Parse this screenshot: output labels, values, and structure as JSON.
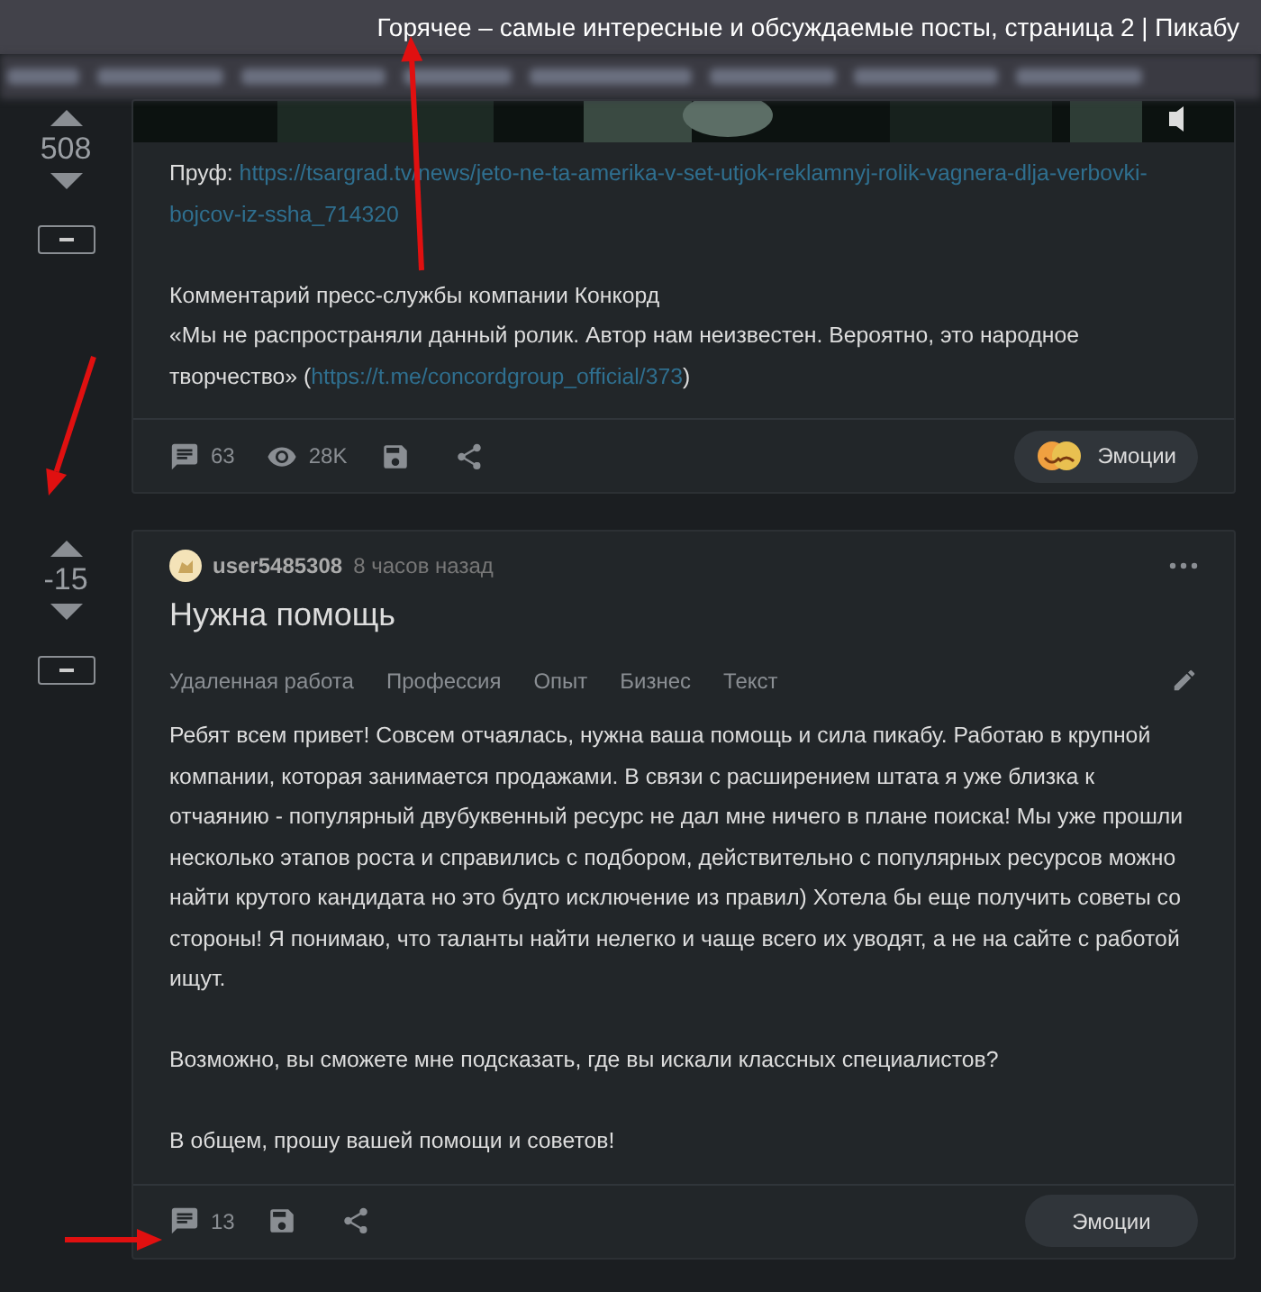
{
  "window": {
    "title": "Горячее – самые интересные и обсуждаемые посты, страница 2 | Пикабу"
  },
  "posts": [
    {
      "rating": "508",
      "media": {
        "kind": "picture"
      },
      "paragraphs": [
        [
          {
            "kind": "text",
            "text": "Пруф: "
          },
          {
            "kind": "link",
            "text": "https://tsargrad.tv/news/jeto-ne-ta-amerika-v-set-utjok-reklamnyj-rolik-vagnera-dlja-verbovki-"
          },
          {
            "kind": "break"
          },
          {
            "kind": "link",
            "text": "bojcov-iz-ssha_714320"
          }
        ],
        [
          {
            "kind": "text",
            "text": "Комментарий пресс-службы компании Конкорд"
          },
          {
            "kind": "break"
          },
          {
            "kind": "text",
            "text": "«Мы не распространяли данный ролик. Автор нам неизвестен. Вероятно, это народное творчество» ("
          },
          {
            "kind": "link",
            "text": "https://t.me/concordgroup_official/373"
          },
          {
            "kind": "text",
            "text": ")"
          }
        ]
      ],
      "comments": "63",
      "views": "28K",
      "emotions": {
        "label": "Эмоции",
        "icon": true
      }
    },
    {
      "rating": "-15",
      "header": {
        "author": "user5485308",
        "time": "8 часов назад",
        "title": "Нужна помощь",
        "tags": [
          "Удаленная работа",
          "Профессия",
          "Опыт",
          "Бизнес",
          "Текст"
        ]
      },
      "paragraphs": [
        [
          {
            "kind": "text",
            "text": "Ребят всем привет! Совсем отчаялась, нужна ваша помощь и сила пикабу. Работаю в крупной компании, которая занимается продажами. В связи с расширением штата я уже близка к отчаянию - популярный двубуквенный ресурс не дал мне ничего в плане поиска! Мы уже прошли несколько этапов роста и справились с подбором, действительно с популярных ресурсов можно найти крутого кандидата но это будто исключение из правил) Хотела бы еще получить советы со стороны! Я понимаю, что таланты найти нелегко и чаще всего их уводят, а не на сайте с работой ищут."
          }
        ],
        [
          {
            "kind": "text",
            "text": "Возможно, вы сможете мне подсказать, где вы искали классных специалистов?"
          }
        ],
        [
          {
            "kind": "text",
            "text": "В общем, прошу вашей помощи и советов!"
          }
        ]
      ],
      "comments": "13",
      "emotions": {
        "label": "Эмоции",
        "icon": false
      }
    }
  ]
}
